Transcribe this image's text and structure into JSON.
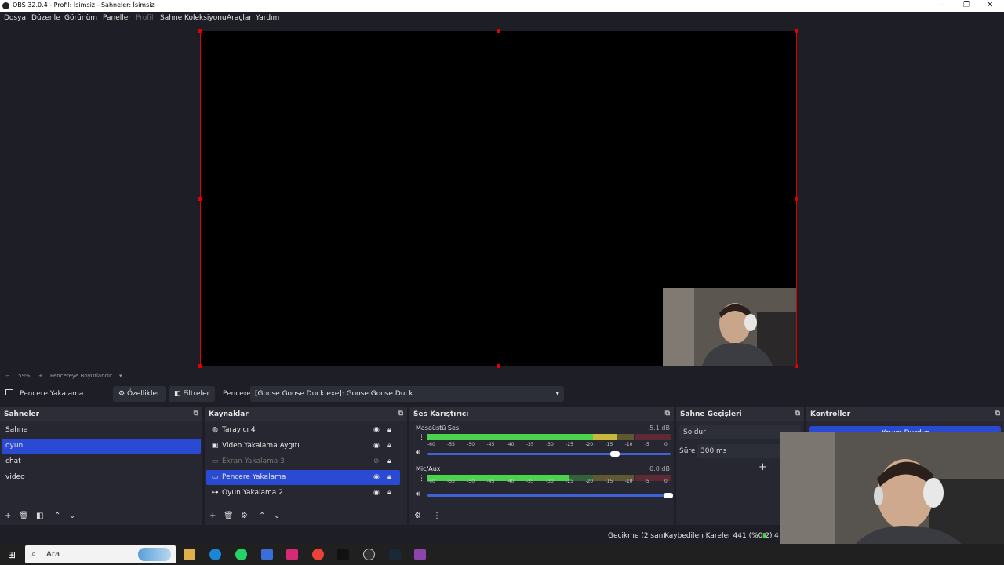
{
  "window": {
    "title": "OBS 32.0.4 - Profil: İsimsiz - Sahneler: İsimsiz"
  },
  "menu": [
    "Dosya",
    "Düzenle",
    "Görünüm",
    "Paneller",
    "Profil",
    "Sahne Koleksiyonu",
    "Araçlar",
    "Yardım"
  ],
  "zoom": {
    "minus": "−",
    "value": "59%",
    "plus": "+",
    "fit_label": "Pencereye Boyutlandır"
  },
  "context": {
    "source_name": "Pencere Yakalama",
    "properties_label": "Özellikler",
    "filters_label": "Filtreler",
    "window_label": "Pencere",
    "window_value": "[Goose Goose Duck.exe]: Goose Goose Duck"
  },
  "scenes": {
    "title": "Sahneler",
    "items": [
      "Sahne",
      "oyun",
      "chat",
      "video"
    ],
    "selected_index": 1
  },
  "sources": {
    "title": "Kaynaklar",
    "items": [
      {
        "name": "Tarayıcı 4",
        "icon": "globe-icon",
        "visible": true
      },
      {
        "name": "Video Yakalama Aygıtı",
        "icon": "camera-icon",
        "visible": true
      },
      {
        "name": "Ekran Yakalama 3",
        "icon": "monitor-icon",
        "visible": false
      },
      {
        "name": "Pencere Yakalama",
        "icon": "window-icon",
        "visible": true,
        "selected": true
      },
      {
        "name": "Oyun Yakalama 2",
        "icon": "gamepad-icon",
        "visible": true
      }
    ]
  },
  "mixer": {
    "title": "Ses Karıştırıcı",
    "channels": [
      {
        "name": "Masaüstü Ses",
        "db": "-5.1 dB",
        "level": 0.78,
        "volume": 0.77
      },
      {
        "name": "Mic/Aux",
        "db": "0.0 dB",
        "level": 0.58,
        "volume": 0.99
      }
    ],
    "ticks": [
      "-60",
      "-55",
      "-50",
      "-45",
      "-40",
      "-35",
      "-30",
      "-25",
      "-20",
      "-15",
      "-10",
      "-5",
      "0"
    ]
  },
  "transitions": {
    "title": "Sahne Geçişleri",
    "selected": "Soldur",
    "duration_label": "Süre",
    "duration_value": "300 ms"
  },
  "controls": {
    "title": "Kontroller",
    "button_label": "Yayını Durdur"
  },
  "status": {
    "delay": "Gecikme (2 san)",
    "dropped": "Kaybedilen Kareler 441 (%0.2)",
    "extra": "4"
  },
  "taskbar": {
    "search_placeholder": "Ara"
  },
  "colors": {
    "accent": "#2b4ad3",
    "selection_border": "#e00000",
    "meter_green": "#4cd34c",
    "meter_yellow": "#c9b73a",
    "meter_red": "#c9323a"
  }
}
